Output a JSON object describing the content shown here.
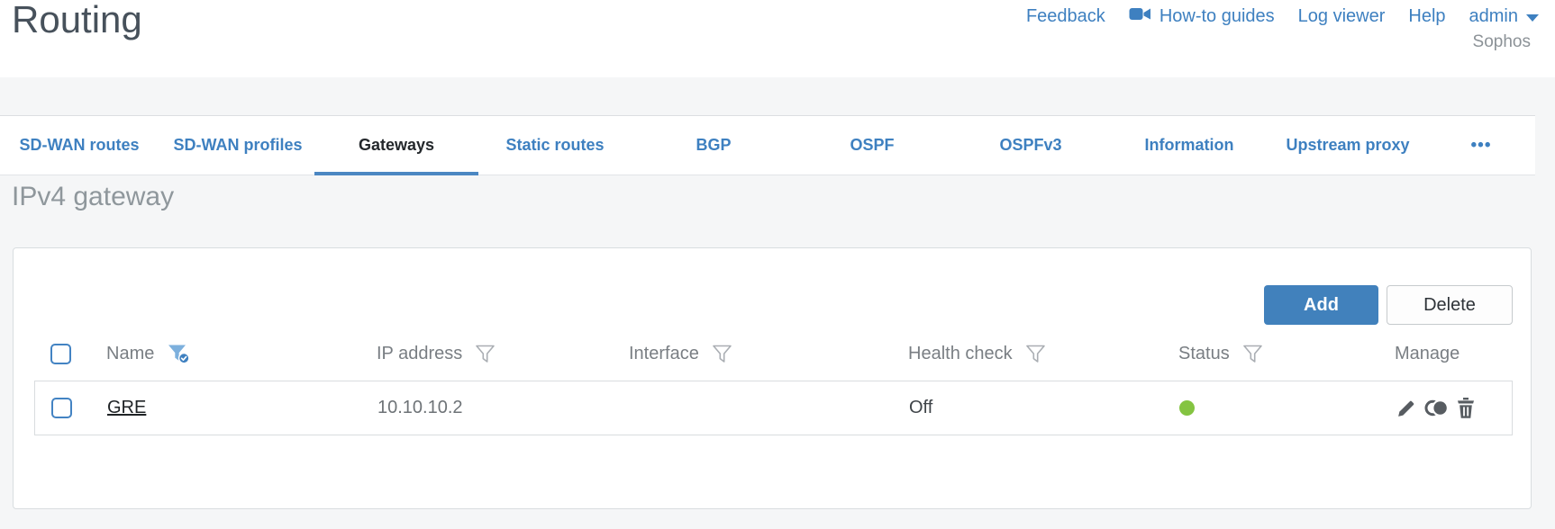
{
  "header": {
    "title": "Routing",
    "nav": {
      "feedback": "Feedback",
      "howto_guides": "How-to guides",
      "log_viewer": "Log viewer",
      "help": "Help",
      "admin": "admin"
    },
    "brand": "Sophos"
  },
  "tabs": {
    "items": [
      {
        "label": "SD-WAN routes",
        "active": false
      },
      {
        "label": "SD-WAN profiles",
        "active": false
      },
      {
        "label": "Gateways",
        "active": true
      },
      {
        "label": "Static routes",
        "active": false
      },
      {
        "label": "BGP",
        "active": false
      },
      {
        "label": "OSPF",
        "active": false
      },
      {
        "label": "OSPFv3",
        "active": false
      },
      {
        "label": "Information",
        "active": false
      },
      {
        "label": "Upstream proxy",
        "active": false
      }
    ],
    "more_label": "•••"
  },
  "section": {
    "title": "IPv4 gateway"
  },
  "toolbar": {
    "add_label": "Add",
    "delete_label": "Delete"
  },
  "table": {
    "columns": [
      {
        "label": "Name",
        "filter": "active"
      },
      {
        "label": "IP address",
        "filter": "default"
      },
      {
        "label": "Interface",
        "filter": "default"
      },
      {
        "label": "Health check",
        "filter": "default"
      },
      {
        "label": "Status",
        "filter": "default"
      },
      {
        "label": "Manage",
        "filter": "none"
      }
    ],
    "rows": [
      {
        "name": "GRE",
        "ip_address": "10.10.10.2",
        "interface": "",
        "health_check": "Off",
        "status": "up",
        "status_style": "#84c441"
      }
    ]
  },
  "colors": {
    "accent_blue": "#3e80c0",
    "add_button_blue": "#4181bc",
    "active_tab_underline": "#4b87c2",
    "status_up_green": "#84c441",
    "title_gray": "#47515b",
    "section_title_gray": "#8f979c"
  }
}
